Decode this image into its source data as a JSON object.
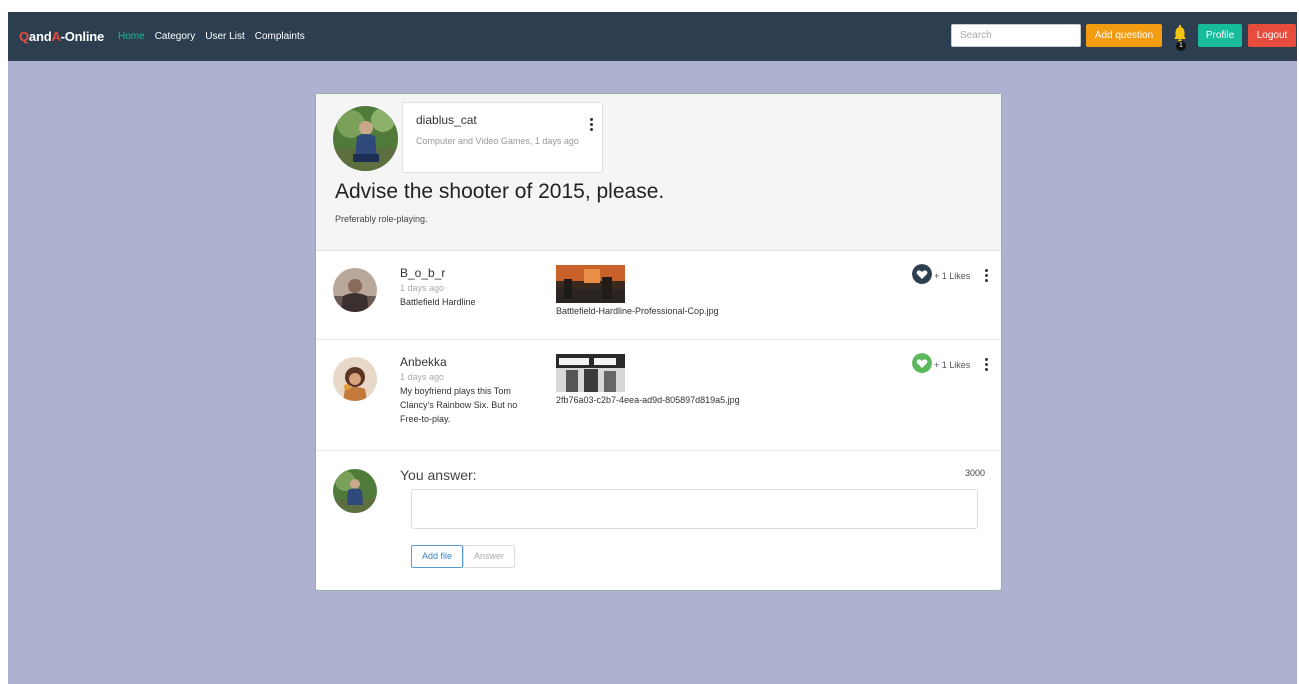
{
  "nav": {
    "brand_q": "Q",
    "brand_and": "and",
    "brand_a": "A",
    "brand_rest": "-Online",
    "links": [
      "Home",
      "Category",
      "User List",
      "Complaints"
    ],
    "search_placeholder": "Search",
    "add_question": "Add question",
    "notification_count": "1",
    "profile": "Profile",
    "logout": "Logout"
  },
  "question": {
    "author": "diablus_cat",
    "meta": "Computer and Video Games, 1 days ago",
    "title": "Advise the shooter of 2015, please.",
    "body": "Preferably role-playing."
  },
  "answers": [
    {
      "author": "B_o_b_r",
      "time": "1 days ago",
      "text": "Battlefield Hardline",
      "file": "Battlefield-Hardline-Professional-Cop.jpg",
      "likes": "+ 1 Likes",
      "like_color": "#2d3e50"
    },
    {
      "author": "Anbekka",
      "time": "1 days ago",
      "text": "My boyfriend plays this Tom Clancy's Rainbow Six. But no Free-to-play.",
      "file": "2fb76a03-c2b7-4eea-ad9d-805897d819a5.jpg",
      "likes": "+ 1 Likes",
      "like_color": "#5cb85c"
    }
  ],
  "compose": {
    "label": "You answer:",
    "counter": "3000",
    "add_file": "Add file",
    "answer": "Answer"
  },
  "colors": {
    "navbar": "#2d3e50",
    "background": "#afb1d1",
    "accent_green": "#18bc9c",
    "warning": "#f39c12",
    "danger": "#e74c3c"
  }
}
